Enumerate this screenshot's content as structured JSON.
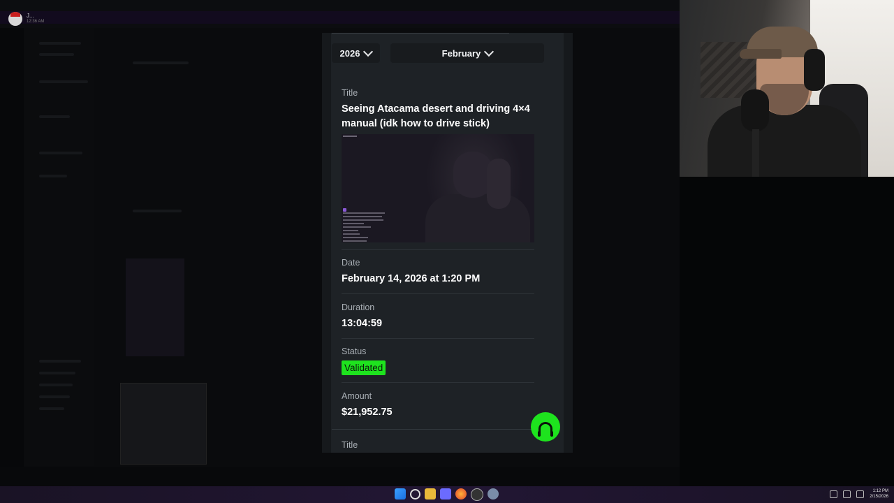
{
  "background_app": {
    "username": "J...",
    "time": "12:36 AM"
  },
  "selectors": {
    "year": "2026",
    "month": "February"
  },
  "record": {
    "title_label": "Title",
    "title": "Seeing Atacama desert and driving 4×4 manual (idk how to drive stick)",
    "date_label": "Date",
    "date": "February 14, 2026 at 1:20 PM",
    "duration_label": "Duration",
    "duration": "13:04:59",
    "status_label": "Status",
    "status": "Validated",
    "amount_label": "Amount",
    "amount": "$21,952.75"
  },
  "next_record": {
    "title_label": "Title"
  },
  "colors": {
    "accent": "#1ee31e",
    "panel": "#1e2226"
  },
  "icons": {
    "support": "headset-icon",
    "chevron": "chevron-down-icon"
  },
  "taskbar": {
    "time": "1:12 PM",
    "date": "2/15/2026"
  }
}
